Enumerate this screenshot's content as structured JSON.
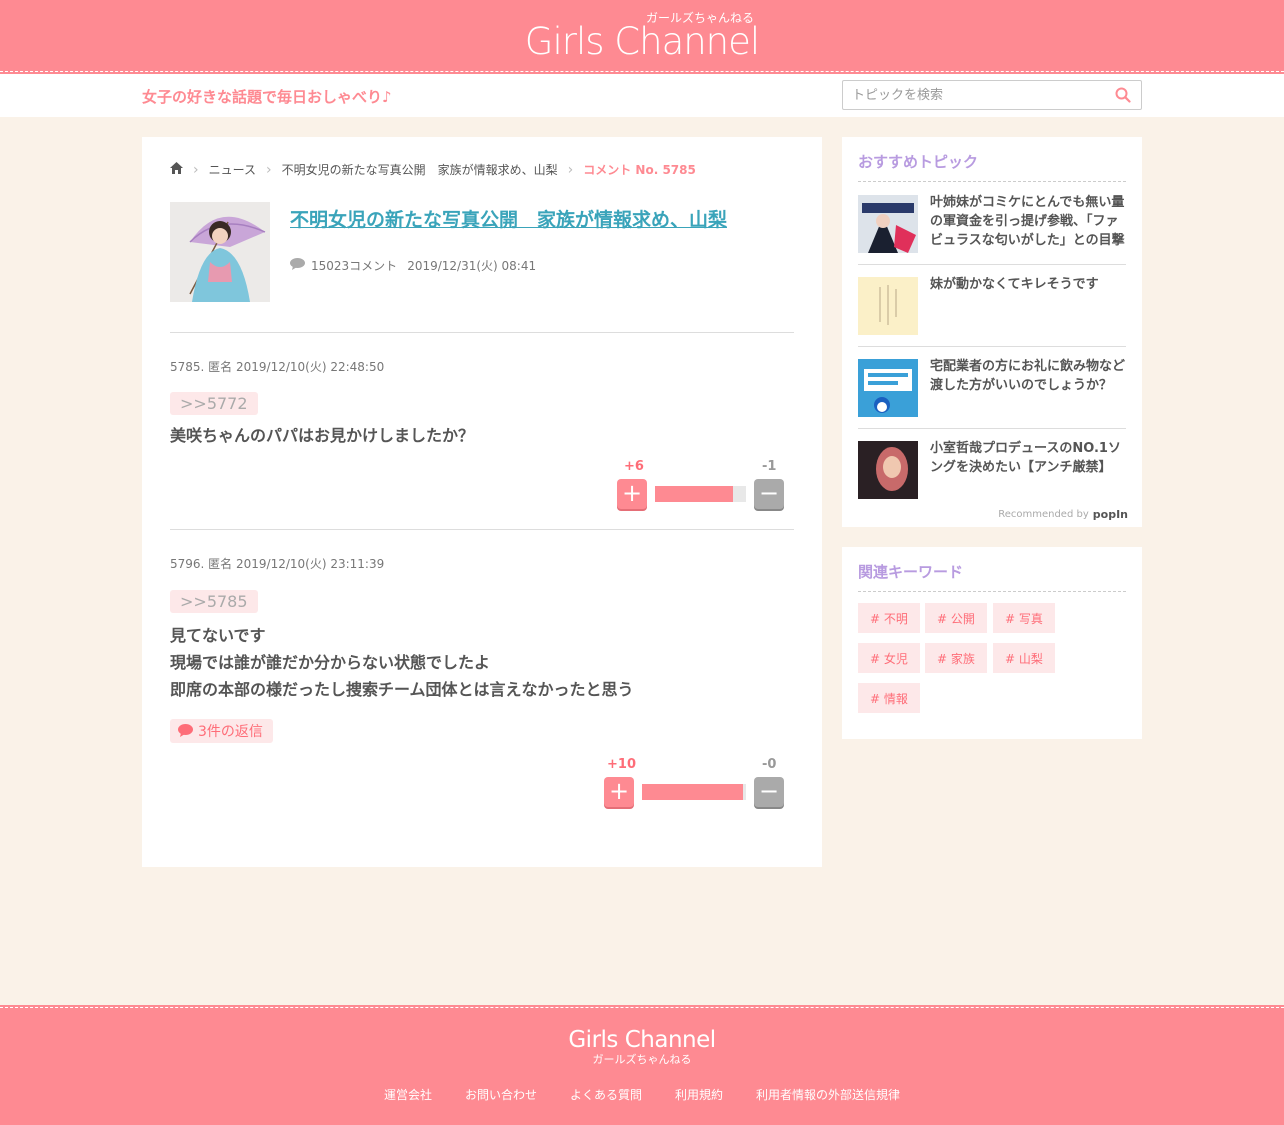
{
  "header": {
    "logo": "Girls Channel",
    "logo_kana": "ガールズちゃんねる"
  },
  "subbar": {
    "tagline": "女子の好きな話題で毎日おしゃべり♪",
    "search_placeholder": "トピックを検索"
  },
  "breadcrumb": {
    "items": [
      "ニュース",
      "不明女児の新たな写真公開　家族が情報求め、山梨"
    ],
    "current": "コメント No. 5785"
  },
  "topic": {
    "title": "不明女児の新たな写真公開　家族が情報求め、山梨",
    "comment_count": "15023コメント",
    "date": "2019/12/31(火) 08:41"
  },
  "comments": [
    {
      "header": "5785. 匿名 2019/12/10(火) 22:48:50",
      "anchor": ">>5772",
      "lines": [
        "美咲ちゃんのパパはお見かけしましたか？"
      ],
      "plus": "+6",
      "minus": "-1",
      "plus_ratio": 0.86
    },
    {
      "header": "5796. 匿名 2019/12/10(火) 23:11:39",
      "anchor": ">>5785",
      "lines": [
        "見てないです",
        "現場では誰が誰だか分からない状態でしたよ",
        "即席の本部の様だったし捜索チーム団体とは言えなかったと思う"
      ],
      "replies": "3件の返信",
      "plus": "+10",
      "minus": "-0",
      "plus_ratio": 0.97
    }
  ],
  "recommended": {
    "heading": "おすすめトピック",
    "items": [
      {
        "title": "叶姉妹がコミケにとんでも無い量の軍資金を引っ提げ参戦、「ファビュラスな匂いがした」との目撃談も"
      },
      {
        "title": "妹が動かなくてキレそうです"
      },
      {
        "title": "宅配業者の方にお礼に飲み物など渡した方がいいのでしょうか？"
      },
      {
        "title": "小室哲哉プロデュースのNO.1ソングを決めたい【アンチ厳禁】"
      }
    ],
    "recommended_by": "Recommended by",
    "popin": "popIn"
  },
  "keywords": {
    "heading": "関連キーワード",
    "items": [
      "# 不明",
      "# 公開",
      "# 写真",
      "# 女児",
      "# 家族",
      "# 山梨",
      "# 情報"
    ]
  },
  "footer": {
    "logo": "Girls Channel",
    "logo_kana": "ガールズちゃんねる",
    "links": [
      "運営会社",
      "お問い合わせ",
      "よくある質問",
      "利用規約",
      "利用者情報の外部送信規律"
    ]
  },
  "colors": {
    "brand_pink": "#fe8a92",
    "link_blue": "#3aa4ba",
    "purple_heading": "#b89be0",
    "background": "#faf2e8"
  }
}
